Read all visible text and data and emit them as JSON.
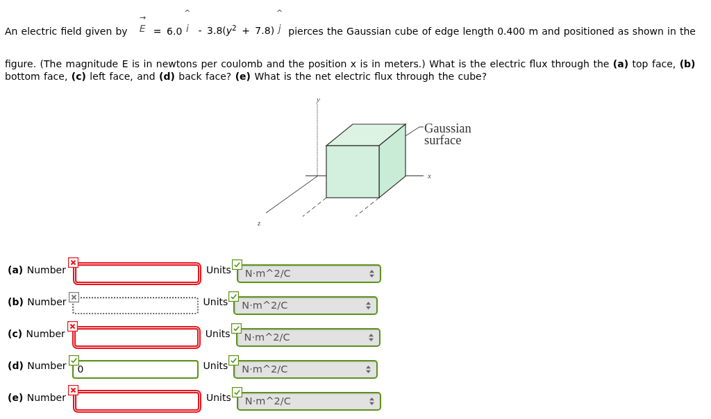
{
  "question": {
    "lead": "An electric field given by",
    "equation": [
      {
        "kind": "vector",
        "symbol": "E",
        "accent": "→"
      },
      {
        "kind": "text",
        "text": "= 6.0"
      },
      {
        "kind": "unit_vector",
        "symbol": "i",
        "accent": "^"
      },
      {
        "kind": "text",
        "text": "- 3.8(*y*$^{2}$ + 7.8)"
      },
      {
        "kind": "unit_vector",
        "symbol": "j",
        "accent": "^"
      }
    ],
    "tail": "pierces the Gaussian cube of edge length 0.400 m and positioned as shown in the",
    "body": "figure. (The magnitude E is in newtons per coulomb and the position x is in meters.) What is the electric flux through the **(a)** top face, **(b)** bottom face, **(c)** left face, and **(d)** back face? **(e)** What is the net electric flux through the cube?"
  },
  "figure": {
    "y_label": "y",
    "x_label": "x",
    "z_label": "z",
    "surface_label": "Gaussian surface"
  },
  "answers": [
    {
      "label": "**(a)** Number",
      "answered": true,
      "correct": false,
      "units_label": "Units",
      "units": "N·m^2/C",
      "units_correct": true
    },
    {
      "label": "**(b)** Number",
      "answered": false,
      "correct": false,
      "units_label": "Units",
      "units": "N·m^2/C",
      "units_correct": true
    },
    {
      "label": "**(c)** Number",
      "answered": true,
      "correct": false,
      "units_label": "Units",
      "units": "N·m^2/C",
      "units_correct": true
    },
    {
      "label": "**(d)** Number",
      "answered": true,
      "correct": true,
      "value": "0",
      "units_label": "Units",
      "units": "N·m^2/C",
      "units_correct": true
    },
    {
      "label": "**(e)** Number",
      "answered": true,
      "correct": false,
      "units_label": "Units",
      "units": "N·m^2/C",
      "units_correct": true
    }
  ]
}
